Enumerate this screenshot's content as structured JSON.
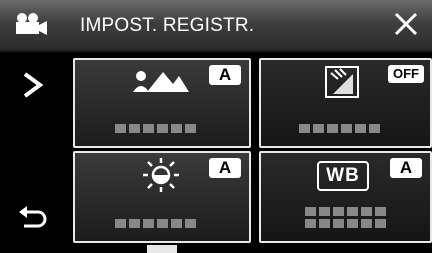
{
  "header": {
    "title": "IMPOST. REGISTR.",
    "mode_icon": "video-camera-icon",
    "close_icon": "close-icon"
  },
  "side": {
    "next_icon": "chevron-right-icon",
    "back_icon": "return-arrow-icon"
  },
  "tiles": [
    {
      "icon": "scene-landscape-icon",
      "badge": "A"
    },
    {
      "icon": "backlight-compensation-icon",
      "badge": "OFF"
    },
    {
      "icon": "brightness-sun-icon",
      "badge": "A"
    },
    {
      "icon": "white-balance-icon",
      "icon_text": "WB",
      "badge": "A"
    }
  ],
  "colors": {
    "header": "#4a4a4a",
    "tile_border": "#e8e8e8",
    "placeholder": "#888888"
  }
}
